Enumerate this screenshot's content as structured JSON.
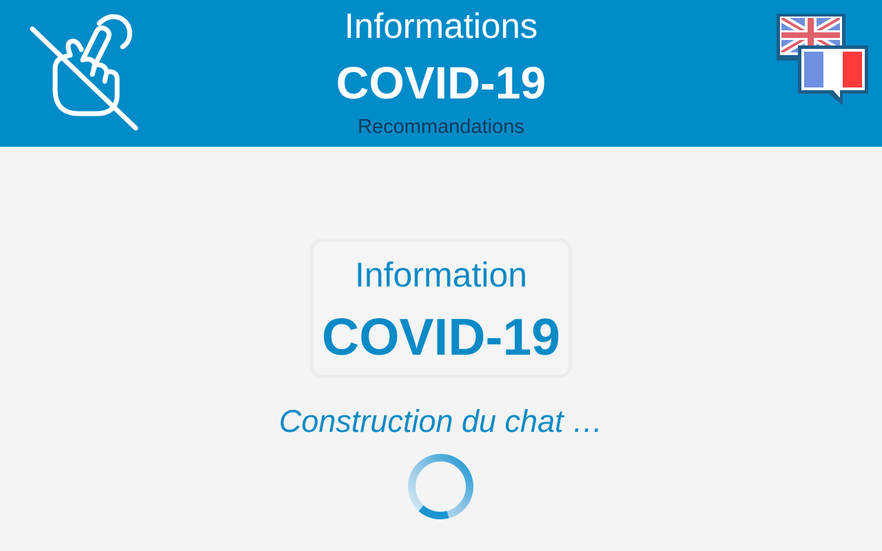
{
  "header": {
    "title_line_1": "Informations",
    "title_line_2": "COVID-19",
    "subtitle": "Recommandations",
    "background_color": "#008bc9"
  },
  "toolbar": {
    "no_touch_icon": "hand-pointer-slash-icon",
    "language_icon": "language-flags-icon",
    "languages": [
      "english",
      "french"
    ]
  },
  "logo": {
    "line_1": "Information",
    "line_2": "COVID-19",
    "color": "#0a8ac6"
  },
  "status": {
    "text": "Construction du chat …",
    "spinner_icon": "loading-spinner-icon"
  }
}
